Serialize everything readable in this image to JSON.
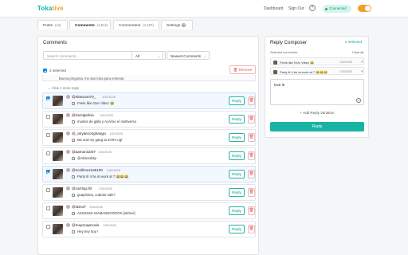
{
  "app": {
    "name_a": "Toka",
    "name_b": "tive"
  },
  "header": {
    "dashboard": "Dashboard",
    "signout": "Sign Out",
    "help": "?",
    "status": "Connected"
  },
  "tabs": [
    {
      "label": "Posts",
      "count": "(14)"
    },
    {
      "label": "Comments",
      "count": "(1,614)"
    },
    {
      "label": "Commenters",
      "count": "(1,427)"
    },
    {
      "label": "Settings",
      "count": ""
    }
  ],
  "comments": {
    "title": "Comments",
    "search_placeholder": "Search comments...",
    "filter_value": "All",
    "sort_value": "Newest Comments",
    "selected_text": "2 selected",
    "remove_label": "Remove",
    "prev_reply": "Buena pregunta: me dan ídea para entrenar",
    "view_more": "View 1 more reply",
    "reply_label": "Reply",
    "items": [
      {
        "user": "@slowcam70_",
        "date": "1/30/2026",
        "text": "Feels like 01er Vibez 😂",
        "checked": true
      },
      {
        "user": "@zarolgalicia",
        "date": "1/30/2026",
        "text": "muslos de gallo y Acórnio el multiverso",
        "checked": false
      },
      {
        "user": "@_anyaeconghasyjo",
        "date": "1/30/2026",
        "text": "Me and my gang at ZARA ngl",
        "checked": false
      },
      {
        "user": "@aamani1007",
        "date": "1/30/2026",
        "text": "@Aldevsbky",
        "checked": false
      },
      {
        "user": "@ocellimezos5100",
        "date": "1/30/2026",
        "text": "Party til 4 be at work at 7 😂😂😂",
        "checked": true
      },
      {
        "user": "@carrlog.rbl",
        "date": "1/30/2026",
        "text": "guapísima, cuándo sale?",
        "checked": false
      },
      {
        "user": "@sDeuT",
        "date": "1/30/2026",
        "text": "ASSKKKK MAMANDOOOOS [sticker]",
        "checked": false
      },
      {
        "user": "@mayscapecula",
        "date": "1/30/2026",
        "text": "Hey hey boy !",
        "checked": false
      }
    ]
  },
  "composer": {
    "title": "Reply Composer",
    "count": "2 selected",
    "selected_label": "Selected comments",
    "clear_all": "Clear all",
    "items": [
      {
        "text": "Feels like 01er Vibez 😂",
        "date": "1/30/2026"
      },
      {
        "text": "Party til 4 be at work at 7 😂😂😂",
        "date": "1/30/2026"
      }
    ],
    "message": "love it!",
    "add_variation": "+ Add Reply Variation",
    "send_label": "Reply"
  },
  "colors": {
    "accent": "#17b3a3",
    "danger": "#d9534f",
    "brand_secondary": "#f0a030"
  }
}
